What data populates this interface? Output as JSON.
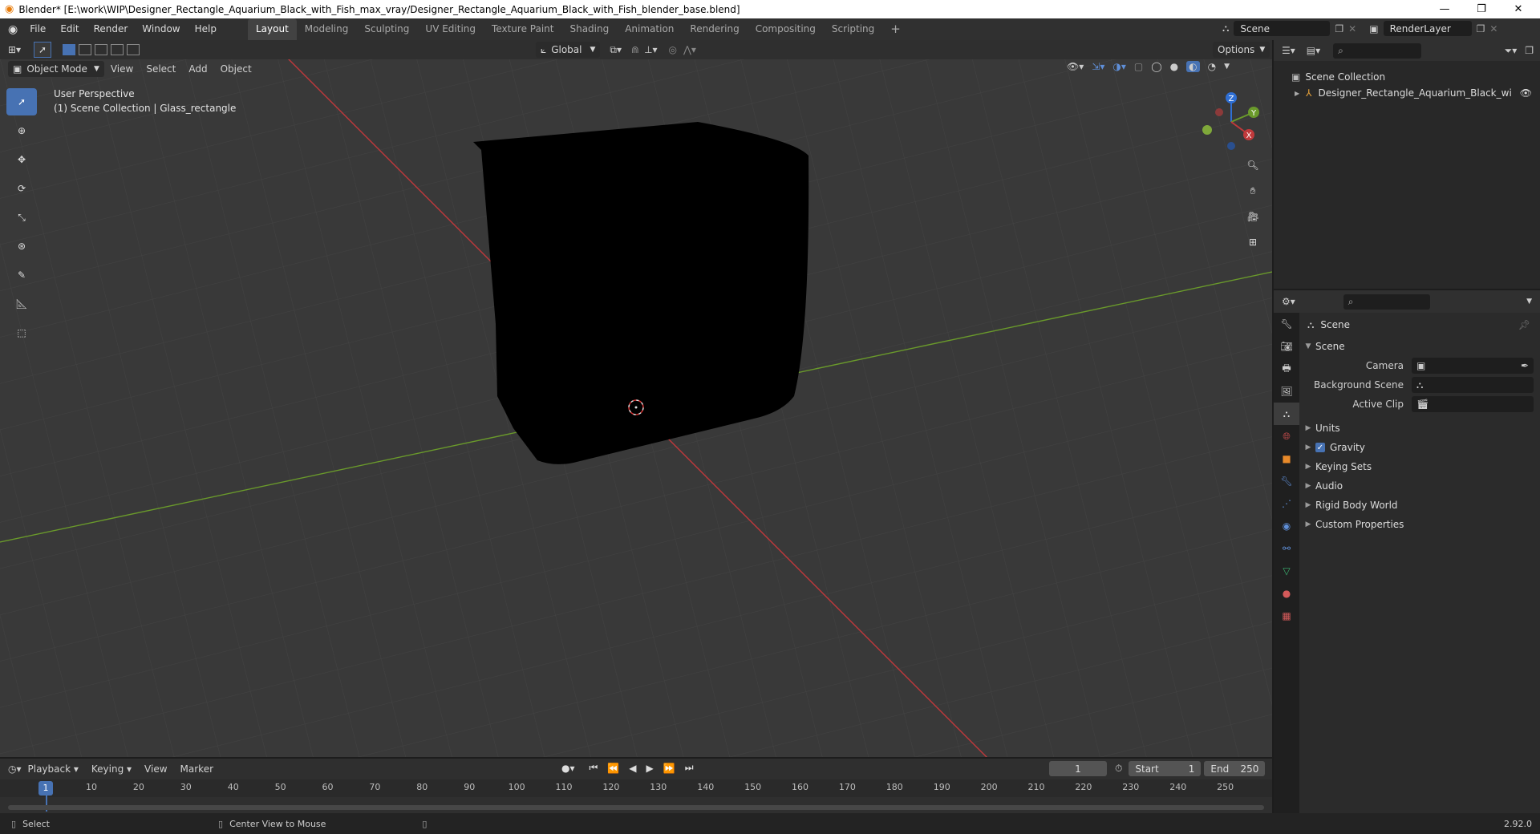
{
  "window": {
    "title": "Blender* [E:\\work\\WIP\\Designer_Rectangle_Aquarium_Black_with_Fish_max_vray/Designer_Rectangle_Aquarium_Black_with_Fish_blender_base.blend]"
  },
  "menus": [
    "File",
    "Edit",
    "Render",
    "Window",
    "Help"
  ],
  "workspaces": [
    "Layout",
    "Modeling",
    "Sculpting",
    "UV Editing",
    "Texture Paint",
    "Shading",
    "Animation",
    "Rendering",
    "Compositing",
    "Scripting"
  ],
  "scene_selector": {
    "value": "Scene"
  },
  "renderlayer_selector": {
    "value": "RenderLayer"
  },
  "viewport_header": {
    "mode": "Object Mode",
    "menus": [
      "View",
      "Select",
      "Add",
      "Object"
    ],
    "orientation": "Global",
    "options": "Options"
  },
  "viewport": {
    "perspective": "User Perspective",
    "collection_info": "(1) Scene Collection | Glass_rectangle",
    "gizmo_labels": {
      "z": "Z",
      "y": "Y",
      "x": "X"
    }
  },
  "outliner": {
    "root": "Scene Collection",
    "items": [
      {
        "label": "Designer_Rectangle_Aquarium_Black_with_I"
      }
    ]
  },
  "properties": {
    "context": "Scene",
    "panel_title": "Scene",
    "fields": [
      {
        "label": "Camera",
        "value": ""
      },
      {
        "label": "Background Scene",
        "value": ""
      },
      {
        "label": "Active Clip",
        "value": ""
      }
    ],
    "sections": [
      "Units",
      "Gravity",
      "Keying Sets",
      "Audio",
      "Rigid Body World",
      "Custom Properties"
    ],
    "gravity_checked": true
  },
  "timeline": {
    "menus": [
      "Playback",
      "Keying",
      "View",
      "Marker"
    ],
    "current_frame": "1",
    "start_label": "Start",
    "start": "1",
    "end_label": "End",
    "end": "250",
    "ruler_ticks": [
      "1",
      "10",
      "20",
      "30",
      "40",
      "50",
      "60",
      "70",
      "80",
      "90",
      "100",
      "110",
      "120",
      "130",
      "140",
      "150",
      "160",
      "170",
      "180",
      "190",
      "200",
      "210",
      "220",
      "230",
      "240",
      "250"
    ]
  },
  "statusbar": {
    "left": "Select",
    "middle": "Center View to Mouse",
    "version": "2.92.0"
  },
  "colors": {
    "accent": "#4772b3",
    "x_axis": "#c0393b",
    "y_axis": "#6a9a2b",
    "z_axis": "#2f6fd4"
  }
}
